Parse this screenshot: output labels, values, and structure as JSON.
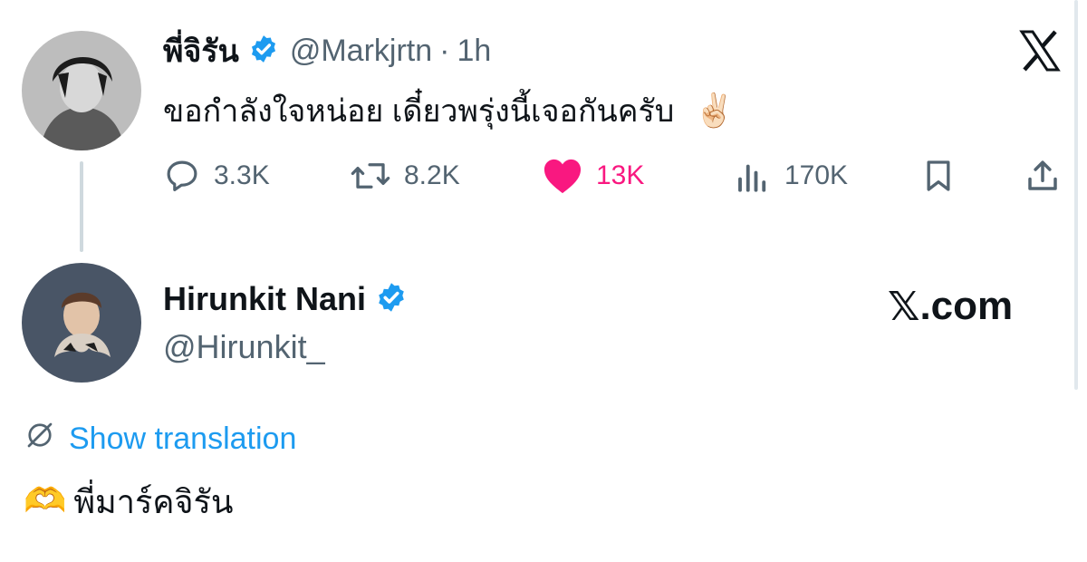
{
  "tweet": {
    "author_name": "พี่จิรัน",
    "author_handle": "@Markjrtn",
    "separator": "·",
    "time": "1h",
    "text": "ขอกำลังใจหน่อย เดี๋ยวพรุ่งนี้เจอกันครับ",
    "emoji": "✌🏻",
    "replies": "3.3K",
    "retweets": "8.2K",
    "likes": "13K",
    "views": "170K"
  },
  "reply": {
    "author_name": "Hirunkit Nani",
    "author_handle": "@Hirunkit_",
    "show_translation": "Show translation",
    "emoji": "🫶",
    "text": "พี่มาร์คจิรัน"
  },
  "branding": {
    "x_logo": "𝕏",
    "x_com_suffix": ".com"
  },
  "colors": {
    "like": "#f91880",
    "link": "#1d9bf0",
    "verified": "#1d9bf0",
    "muted": "#536471"
  },
  "icons": [
    "verified-badge-icon",
    "reply-icon",
    "retweet-icon",
    "like-heart-icon",
    "views-icon",
    "bookmark-icon",
    "share-icon",
    "globe-slash-icon"
  ]
}
